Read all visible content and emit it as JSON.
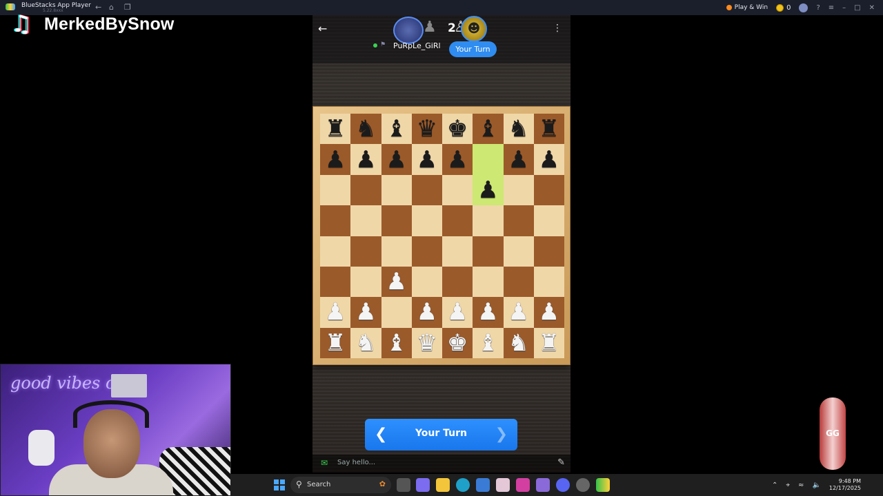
{
  "window": {
    "title": "BlueStacks App Player",
    "subtitle": "5.22.8xxx",
    "play_win_label": "Play & Win",
    "coin_count": "0"
  },
  "overlay": {
    "streamer_name": "MerkedBySnow",
    "neon_sign": "good vibes o"
  },
  "game": {
    "score": "2",
    "opponent_name": "PuRpLe_GiRl",
    "turn_badge": "Your Turn",
    "turn_button": "Your Turn",
    "chat_placeholder": "Say hello...",
    "board": [
      [
        "r",
        "n",
        "b",
        "q",
        "k",
        "b",
        "n",
        "r"
      ],
      [
        "p",
        "p",
        "p",
        "p",
        "p",
        "",
        "p",
        "p"
      ],
      [
        "",
        "",
        "",
        "",
        "",
        "p",
        "",
        ""
      ],
      [
        "",
        "",
        "",
        "",
        "",
        "",
        "",
        ""
      ],
      [
        "",
        "",
        "",
        "",
        "",
        "",
        "",
        ""
      ],
      [
        "",
        "",
        "P",
        "",
        "",
        "",
        "",
        ""
      ],
      [
        "P",
        "P",
        "",
        "P",
        "P",
        "P",
        "P",
        "P"
      ],
      [
        "R",
        "N",
        "B",
        "Q",
        "K",
        "B",
        "N",
        "R"
      ]
    ],
    "highlight_squares": [
      [
        1,
        5
      ],
      [
        2,
        5
      ]
    ],
    "colors": {
      "light": "#f0d7a8",
      "dark": "#9b5a2a",
      "highlight": "#cde873",
      "accent": "#2f8cf0"
    }
  },
  "badge": {
    "label": "GG"
  },
  "taskbar": {
    "search_label": "Search",
    "time": "9:48 PM",
    "date": "12/17/2025"
  }
}
